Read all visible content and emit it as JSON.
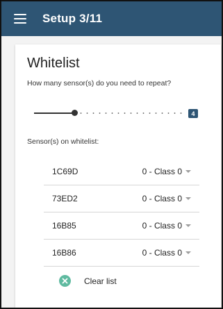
{
  "appbar": {
    "title": "Setup 3/11",
    "menu_icon": "hamburger-menu-icon"
  },
  "card": {
    "title": "Whitelist",
    "question": "How many sensor(s) do you need to repeat?",
    "slider": {
      "value": "4",
      "level": 0.27
    },
    "whitelist_label": "Sensor(s) on whitelist:",
    "sensors": [
      {
        "id": "1C69D",
        "class": "0 - Class 0"
      },
      {
        "id": "73ED2",
        "class": "0 - Class 0"
      },
      {
        "id": "16B85",
        "class": "0 - Class 0"
      },
      {
        "id": "16B86",
        "class": "0 - Class 0"
      }
    ],
    "clear_label": "Clear list",
    "clear_icon": "clear-circle-icon"
  },
  "colors": {
    "appbar": "#2e5574",
    "accent": "#5fbaa0",
    "background": "#f3f3f3"
  }
}
